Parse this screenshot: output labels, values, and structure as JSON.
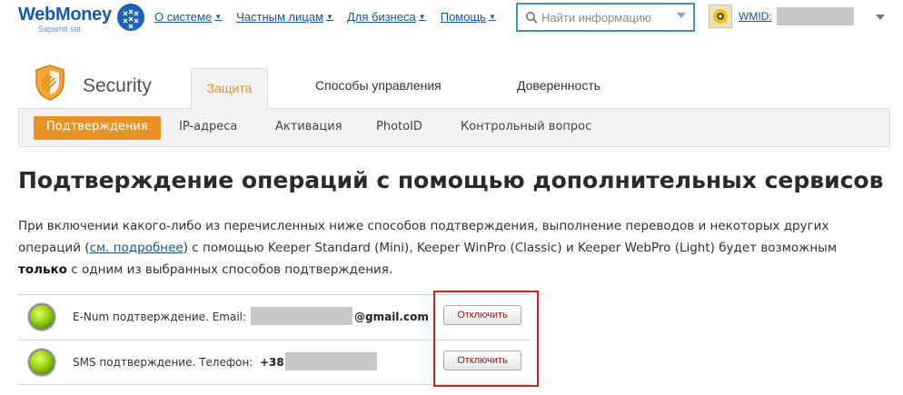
{
  "header": {
    "logo_text": "WebMoney",
    "logo_sub": "Sapienti sat",
    "nav": [
      "О системе",
      "Частным лицам",
      "Для бизнеса",
      "Помощь"
    ],
    "search_placeholder": "Найти информацию",
    "wmid_label": "WMID:"
  },
  "section": {
    "title": "Security",
    "tabs": [
      "Защита",
      "Способы управления",
      "Доверенность"
    ],
    "active_tab": "Защита",
    "subtabs": [
      "Подтверждения",
      "IP-адреса",
      "Активация",
      "PhotoID",
      "Контрольный вопрос"
    ],
    "active_subtab": "Подтверждения"
  },
  "content": {
    "title": "Подтверждение операций с помощью дополнительных сервисов",
    "desc_line1": "При включении какого-либо из перечисленных ниже способов подтверждения, выполнение переводов и некоторых других",
    "desc_line2_pre": "операций (",
    "desc_link": "см. подробнее",
    "desc_line2_post": ") с помощью Keeper Standard (Mini), Keeper WinPro (Classic) и Keeper WebPro (Light) будет возможным",
    "desc_bold": "только",
    "desc_line3_post": " с одним из выбранных способов подтверждения.",
    "confirmations": [
      {
        "label": "E-Num подтверждение. Email:",
        "suffix": "@gmail.com",
        "button": "Отключить"
      },
      {
        "label": "SMS подтверждение. Телефон:",
        "suffix": "+38",
        "button": "Отключить"
      }
    ]
  },
  "colors": {
    "accent": "#e79126",
    "link": "#1a55a0",
    "highlight": "#d92020",
    "status_on": "#9ad20a"
  }
}
